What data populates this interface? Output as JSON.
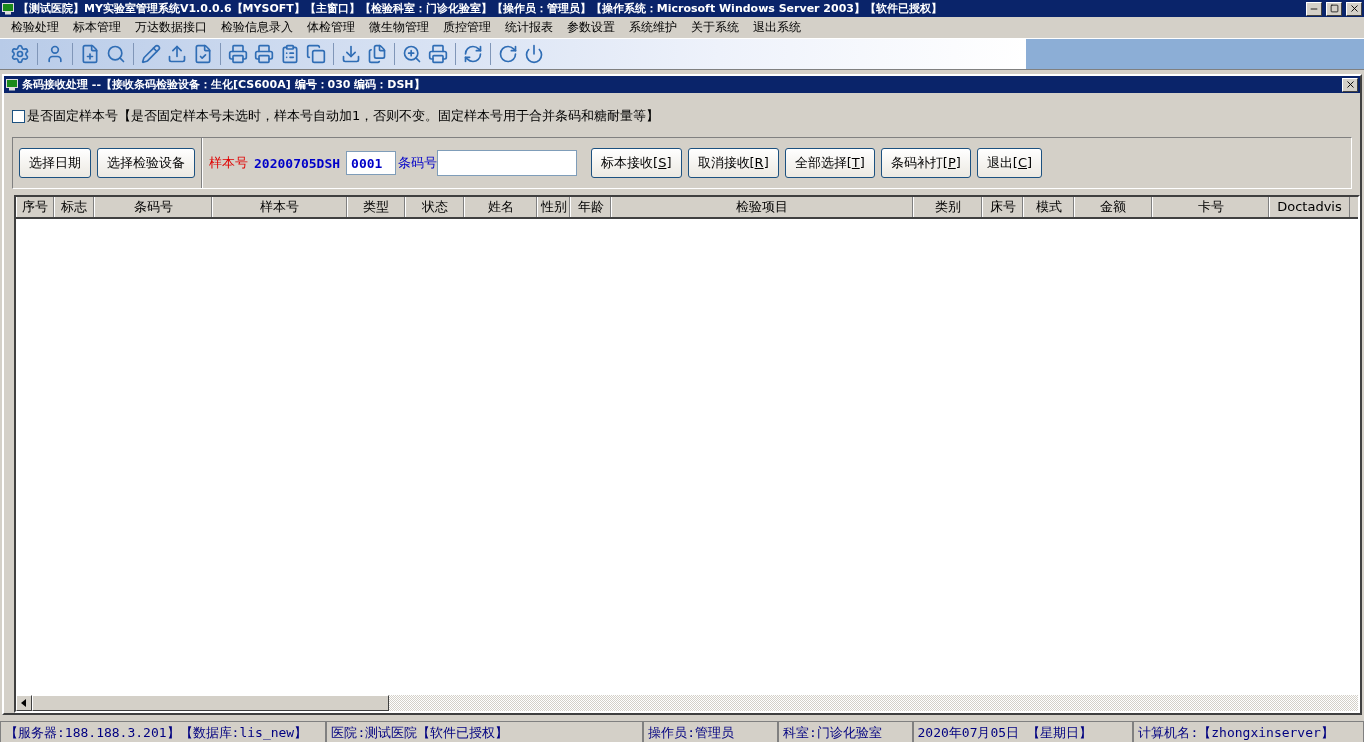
{
  "window": {
    "title": "【测试医院】MY实验室管理系统V1.0.0.6【MYSOFT】【主窗口】【检验科室：门诊化验室】【操作员：管理员】【操作系统：Microsoft Windows Server 2003】【软件已授权】"
  },
  "menu": [
    "检验处理",
    "标本管理",
    "万达数据接口",
    "检验信息录入",
    "体检管理",
    "微生物管理",
    "质控管理",
    "统计报表",
    "参数设置",
    "系统维护",
    "关于系统",
    "退出系统"
  ],
  "child_window": {
    "title": "条码接收处理 --【接收条码检验设备：生化[CS600A] 编号：030 编码：DSH】"
  },
  "fixed_sample": {
    "label": "是否固定样本号【是否固定样本号未选时，样本号自动加1，否则不变。固定样本号用于合并条码和糖耐量等】",
    "checked": false
  },
  "left_buttons": [
    "选择日期",
    "选择检验设备"
  ],
  "sample_label": "样本号",
  "sample_prefix": "20200705DSH",
  "sample_number": "0001",
  "barcode_label": "条码号",
  "action_buttons": [
    {
      "text": "标本接收[",
      "key": "S",
      "end": "]"
    },
    {
      "text": "取消接收[",
      "key": "R",
      "end": "]"
    },
    {
      "text": "全部选择[",
      "key": "T",
      "end": "]"
    },
    {
      "text": "条码补打[",
      "key": "P",
      "end": "]"
    },
    {
      "text": "退出[",
      "key": "C",
      "end": "]"
    }
  ],
  "table": {
    "columns": [
      "序号",
      "标志",
      "条码号",
      "样本号",
      "类型",
      "状态",
      "姓名",
      "性别",
      "年龄",
      "检验项目",
      "类别",
      "床号",
      "模式",
      "金额",
      "卡号",
      "Doctadvis"
    ]
  },
  "status_bar": [
    "【服务器:188.188.3.201】【数据库:lis_new】",
    "医院:测试医院【软件已授权】",
    "操作员:管理员",
    "科室:门诊化验室",
    "2020年07月05日 【星期日】",
    "计算机名:【zhongxinserver】"
  ]
}
